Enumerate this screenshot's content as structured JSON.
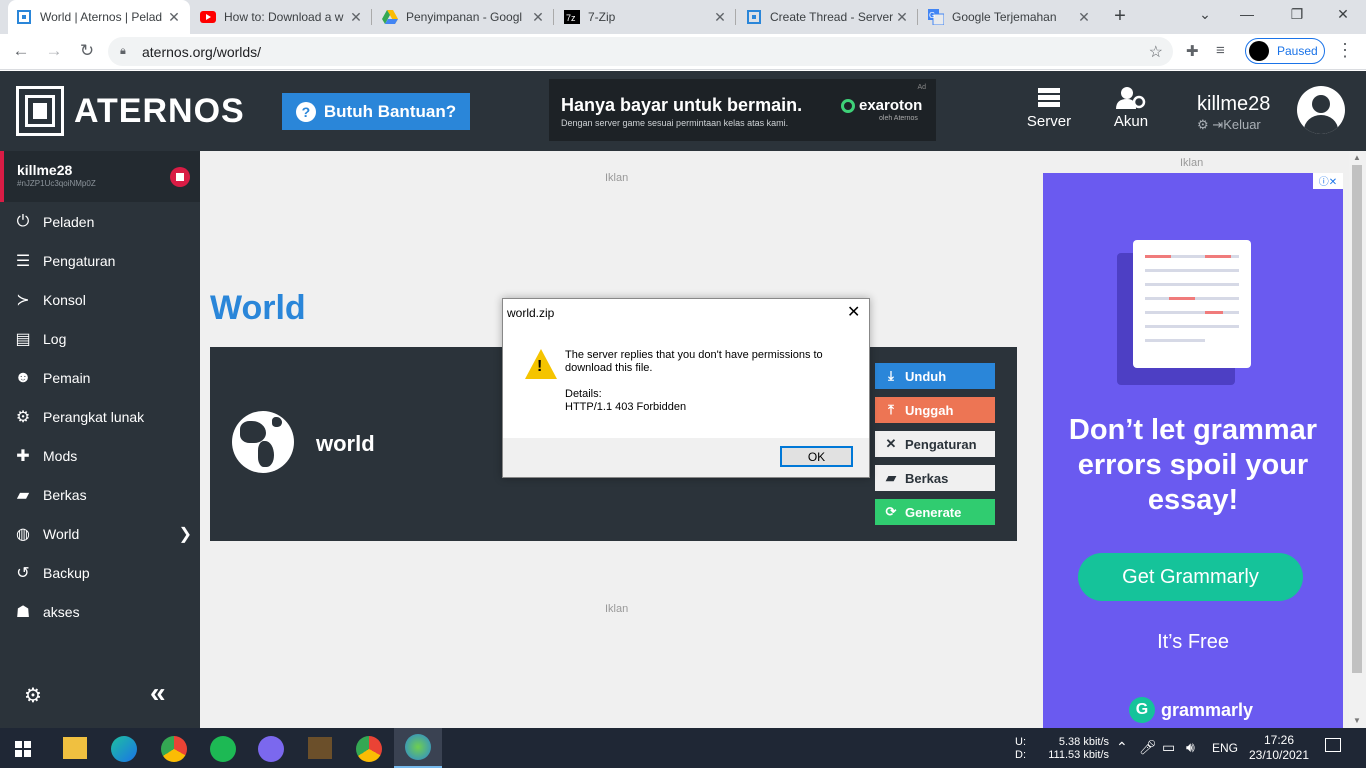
{
  "browser": {
    "tabs": [
      {
        "title": "World | Aternos | Pelad",
        "icon": "aternos-icon",
        "color": "#2a86d9"
      },
      {
        "title": "How to: Download a w",
        "icon": "youtube-icon",
        "color": "#ff0000"
      },
      {
        "title": "Penyimpanan - Googl",
        "icon": "google-drive-icon",
        "color": "#34a853"
      },
      {
        "title": "7-Zip",
        "icon": "7zip-icon",
        "color": "#000000"
      },
      {
        "title": "Create Thread - Server",
        "icon": "aternos-icon",
        "color": "#2a86d9"
      },
      {
        "title": "Google Terjemahan",
        "icon": "google-translate-icon",
        "color": "#4285f4"
      }
    ],
    "url": "aternos.org/worlds/",
    "profile_status": "Paused"
  },
  "site": {
    "logo_text": "ATERNOS",
    "help_button": "Butuh Bantuan?",
    "ad_banner": {
      "headline": "Hanya bayar untuk bermain.",
      "sub": "Dengan server game sesuai permintaan kelas atas kami.",
      "brand": "exaroton",
      "brand_sub": "oleh Aternos",
      "tag": "Ad"
    },
    "nav": [
      {
        "label": "Server",
        "icon": "server-icon"
      },
      {
        "label": "Akun",
        "icon": "account-icon"
      }
    ],
    "user": {
      "name": "killme28",
      "logout": "Keluar"
    }
  },
  "sidebar": {
    "server_name": "killme28",
    "server_id": "#nJZP1Uc3qoiNMp0Z",
    "items": [
      {
        "label": "Peladen",
        "icon": "power-icon",
        "glyph": "⏻"
      },
      {
        "label": "Pengaturan",
        "icon": "sliders-icon",
        "glyph": "☰"
      },
      {
        "label": "Konsol",
        "icon": "terminal-icon",
        "glyph": "≻"
      },
      {
        "label": "Log",
        "icon": "file-icon",
        "glyph": "▤"
      },
      {
        "label": "Pemain",
        "icon": "users-icon",
        "glyph": "☻"
      },
      {
        "label": "Perangkat lunak",
        "icon": "cogs-icon",
        "glyph": "⚙"
      },
      {
        "label": "Mods",
        "icon": "puzzle-icon",
        "glyph": "✚"
      },
      {
        "label": "Berkas",
        "icon": "folder-icon",
        "glyph": "▰"
      },
      {
        "label": "World",
        "icon": "globe-icon",
        "glyph": "◍"
      },
      {
        "label": "Backup",
        "icon": "history-icon",
        "glyph": "↺"
      },
      {
        "label": "akses",
        "icon": "user-lock-icon",
        "glyph": "☗"
      }
    ]
  },
  "main": {
    "ad_label": "Iklan",
    "title": "World",
    "world_name": "world",
    "actions": [
      {
        "label": "Unduh",
        "icon": "download-icon",
        "glyph": "⤓",
        "bg": "#2a86d9",
        "fg": "#ffffff"
      },
      {
        "label": "Unggah",
        "icon": "upload-icon",
        "glyph": "⤒",
        "bg": "#ed7554",
        "fg": "#ffffff"
      },
      {
        "label": "Pengaturan",
        "icon": "tools-icon",
        "glyph": "✕",
        "bg": "#f0f0f0",
        "fg": "#2b333a"
      },
      {
        "label": "Berkas",
        "icon": "folder-icon",
        "glyph": "▰",
        "bg": "#f0f0f0",
        "fg": "#2b333a"
      },
      {
        "label": "Generate",
        "icon": "refresh-icon",
        "glyph": "⟳",
        "bg": "#30cc70",
        "fg": "#ffffff"
      }
    ]
  },
  "grammarly_ad": {
    "headline": "Don’t let grammar errors spoil your essay!",
    "cta": "Get Grammarly",
    "sub": "It’s Free",
    "brand": "grammarly"
  },
  "dialog": {
    "title": "world.zip",
    "message": "The server replies that you don't have permissions to download this file.",
    "details_label": "Details:",
    "details_value": "HTTP/1.1 403 Forbidden",
    "ok": "OK"
  },
  "taskbar": {
    "net_up_label": "U:",
    "net_down_label": "D:",
    "net_up": "5.38 kbit/s",
    "net_down": "111.53 kbit/s",
    "lang": "ENG",
    "time": "17:26",
    "date": "23/10/2021"
  }
}
